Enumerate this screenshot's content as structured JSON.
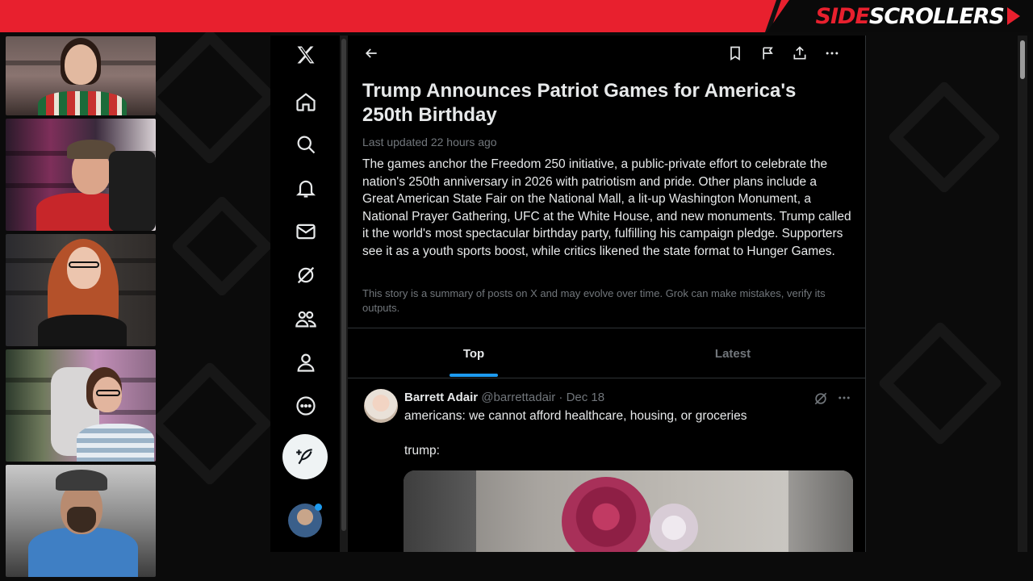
{
  "brand": {
    "side": "SIDE",
    "scrollers": "SCROLLERS"
  },
  "colors": {
    "banner_red": "#e8202e",
    "accent_blue": "#1d9bf0",
    "x_background": "#000000",
    "text_primary": "#e7e9ea",
    "text_secondary": "#71767b"
  },
  "webcams": [
    {
      "id": "cam-1",
      "shirt": "christmas-sweater",
      "background": "festive-room"
    },
    {
      "id": "cam-2",
      "shirt": "red-christmas-sweater",
      "background": "game-shelves-red-light"
    },
    {
      "id": "cam-3",
      "shirt": "black",
      "background": "collectibles-shelves"
    },
    {
      "id": "cam-4",
      "shirt": "striped",
      "background": "pink-lit-game-room"
    },
    {
      "id": "cam-5",
      "shirt": "blue-jacket",
      "background": "car-interior"
    }
  ],
  "sidebar": {
    "items": [
      {
        "icon": "x-logo-icon"
      },
      {
        "icon": "home-icon"
      },
      {
        "icon": "search-icon"
      },
      {
        "icon": "bell-icon"
      },
      {
        "icon": "mail-icon"
      },
      {
        "icon": "grok-icon"
      },
      {
        "icon": "communities-icon"
      },
      {
        "icon": "profile-icon"
      },
      {
        "icon": "more-circle-icon"
      }
    ],
    "post_button_icon": "feather-plus-icon"
  },
  "topbar": {
    "icons": [
      "back-arrow-icon",
      "bookmark-icon",
      "flag-icon",
      "share-icon",
      "more-icon"
    ]
  },
  "story": {
    "title": "Trump Announces Patriot Games for America's 250th Birthday",
    "updated": "Last updated 22 hours ago",
    "summary": "The games anchor the Freedom 250 initiative, a public-private effort to celebrate the nation's 250th anniversary in 2026 with patriotism and pride. Other plans include a Great American State Fair on the National Mall, a lit-up Washington Monument, a National Prayer Gathering, UFC at the White House, and new monuments. Trump called it the world's most spectacular birthday party, fulfilling his campaign pledge. Supporters see it as a youth sports boost, while critics likened the state format to Hunger Games.",
    "disclaimer": "This story is a summary of posts on X and may evolve over time. Grok can make mistakes, verify its outputs."
  },
  "tabs": [
    {
      "label": "Top",
      "selected": true
    },
    {
      "label": "Latest",
      "selected": false
    }
  ],
  "post": {
    "name": "Barrett Adair",
    "handle": "@barrettadair",
    "separator": "·",
    "date": "Dec 18",
    "line1": "americans: we cannot afford healthcare, housing, or groceries",
    "line2": "trump:"
  }
}
